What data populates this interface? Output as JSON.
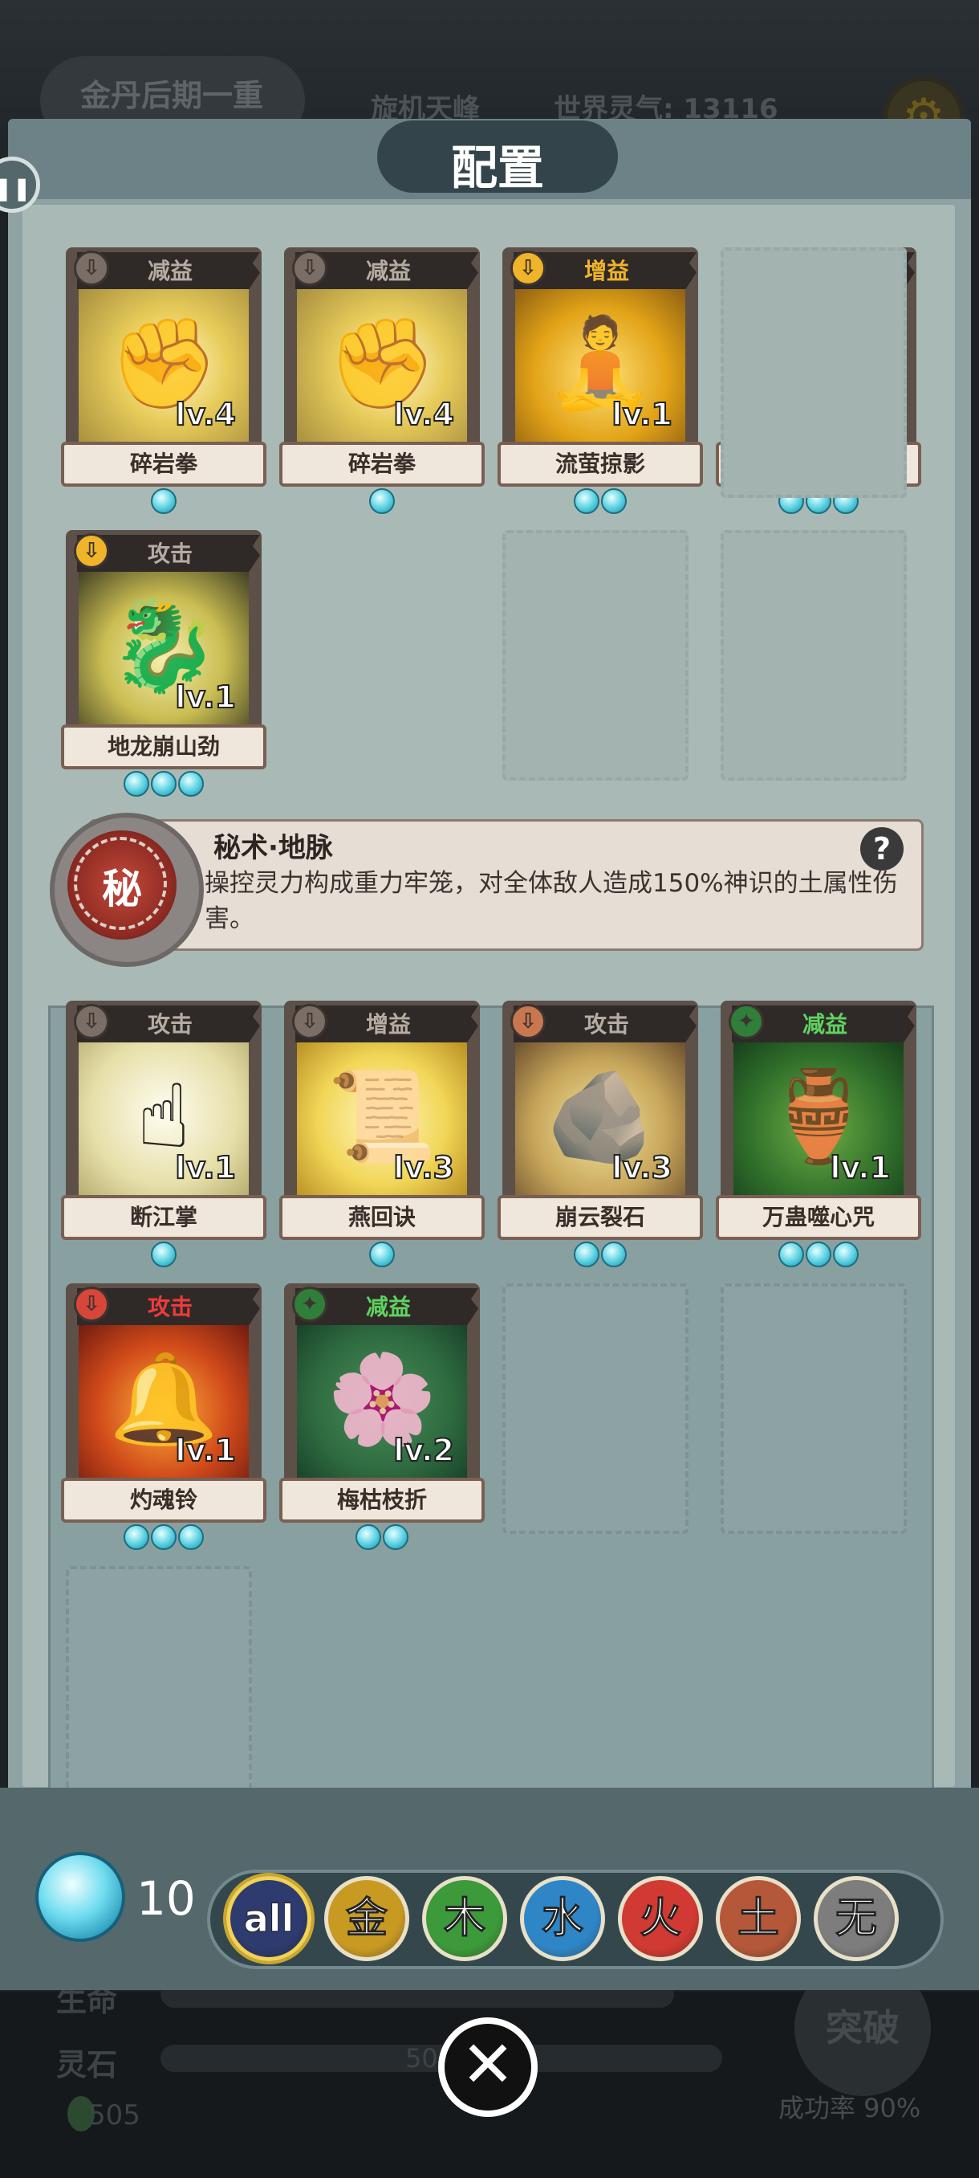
{
  "background": {
    "realm": "金丹后期一重",
    "peak": "旋机天峰",
    "world_qi_label": "世界灵气: 13116",
    "bottom_rows": [
      "生命",
      "灵石"
    ],
    "spirit_stone_value": "50",
    "bottom_count": "505",
    "breakthrough": "突破",
    "success_rate": "成功率 90%"
  },
  "panel": {
    "title": "配置"
  },
  "equipped_cards": [
    {
      "tag": "减益",
      "tag_color": "#b7aca3",
      "level": "lv.4",
      "name": "碎岩拳",
      "cost": 1,
      "art": "rock-fist",
      "element": "none"
    },
    {
      "tag": "减益",
      "tag_color": "#b7aca3",
      "level": "lv.4",
      "name": "碎岩拳",
      "cost": 1,
      "art": "rock-fist",
      "element": "none"
    },
    {
      "tag": "增益",
      "tag_color": "#f0b42a",
      "level": "lv.1",
      "name": "流萤掠影",
      "cost": 2,
      "art": "golden-figure",
      "element": "gold"
    },
    {
      "tag": "攻击",
      "tag_color": "#b7aca3",
      "level": "lv.1",
      "name": "地龙崩山劲",
      "cost": 3,
      "art": "earth-dragon",
      "element": "gold"
    },
    {
      "tag": "攻击",
      "tag_color": "#b7aca3",
      "level": "lv.1",
      "name": "地龙崩山劲",
      "cost": 3,
      "art": "earth-dragon",
      "element": "gold"
    }
  ],
  "secret_art": {
    "emblem": "秘",
    "title": "秘术·地脉",
    "description": "操控灵力构成重力牢笼，对全体敌人造成150%神识的土属性伤害。",
    "help": "?"
  },
  "inventory_cards": [
    {
      "tag": "攻击",
      "tag_color": "#b7aca3",
      "level": "lv.1",
      "name": "断江掌",
      "cost": 1,
      "art": "finger",
      "element": "none"
    },
    {
      "tag": "增益",
      "tag_color": "#b7aca3",
      "level": "lv.3",
      "name": "燕回诀",
      "cost": 1,
      "art": "scroll",
      "element": "none"
    },
    {
      "tag": "攻击",
      "tag_color": "#b7aca3",
      "level": "lv.3",
      "name": "崩云裂石",
      "cost": 2,
      "art": "stone",
      "element": "earth"
    },
    {
      "tag": "减益",
      "tag_color": "#5fd35f",
      "level": "lv.1",
      "name": "万蛊噬心咒",
      "cost": 3,
      "art": "pot",
      "element": "wood"
    },
    {
      "tag": "攻击",
      "tag_color": "#ef3b3b",
      "level": "lv.1",
      "name": "灼魂铃",
      "cost": 3,
      "art": "bell",
      "element": "fire"
    },
    {
      "tag": "减益",
      "tag_color": "#5fd35f",
      "level": "lv.2",
      "name": "梅枯枝折",
      "cost": 2,
      "art": "blossom",
      "element": "wood"
    }
  ],
  "resource": {
    "count": "10",
    "icon": "spirit-crystal-icon"
  },
  "filters": [
    {
      "label": "all",
      "color": "#2d3b6e",
      "selected": true
    },
    {
      "label": "金",
      "color": "#c99a22",
      "selected": false
    },
    {
      "label": "木",
      "color": "#3d9a3a",
      "selected": false
    },
    {
      "label": "水",
      "color": "#2f86c6",
      "selected": false
    },
    {
      "label": "火",
      "color": "#d03a32",
      "selected": false
    },
    {
      "label": "土",
      "color": "#b5583a",
      "selected": false
    },
    {
      "label": "无",
      "color": "#7d7d7d",
      "selected": false
    }
  ],
  "close": {
    "icon": "close-icon",
    "glyph": "✕"
  }
}
